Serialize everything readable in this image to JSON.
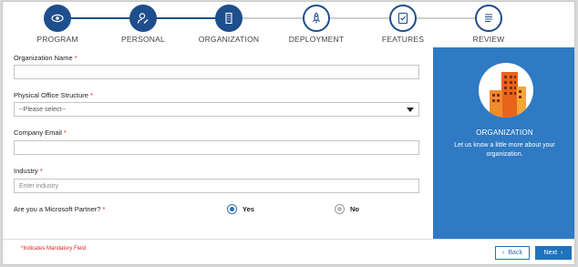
{
  "stepper": {
    "steps": [
      {
        "label": "PROGRAM",
        "icon": "eye-icon",
        "state": "done"
      },
      {
        "label": "PERSONAL",
        "icon": "user-edit-icon",
        "state": "done"
      },
      {
        "label": "ORGANIZATION",
        "icon": "building-icon",
        "state": "done"
      },
      {
        "label": "DEPLOYMENT",
        "icon": "rocket-icon",
        "state": "todo"
      },
      {
        "label": "FEATURES",
        "icon": "checklist-icon",
        "state": "todo"
      },
      {
        "label": "REVIEW",
        "icon": "document-list-icon",
        "state": "todo"
      }
    ],
    "progress_color": "#1e4e8c",
    "pending_color": "#cfcfcf"
  },
  "form": {
    "org_name": {
      "label": "Organization Name",
      "value": "",
      "required_mark": "*"
    },
    "office_structure": {
      "label": "Physical Office Structure",
      "selected": "--Please select--",
      "required_mark": "*"
    },
    "company_email": {
      "label": "Company Email",
      "value": "",
      "required_mark": "*"
    },
    "industry": {
      "label": "Industry",
      "placeholder": "Enter industry",
      "required_mark": "*"
    },
    "partner": {
      "label": "Are you a Microsoft Partner?",
      "required_mark": "*",
      "options": [
        {
          "label": "Yes",
          "selected": true
        },
        {
          "label": "No",
          "selected": false
        }
      ]
    }
  },
  "panel": {
    "title": "ORGANIZATION",
    "description": "Let us know a little more about your organization.",
    "icon": "building-illustration-icon",
    "background": "#2f7ac3"
  },
  "footer": {
    "mandatory_note": "*Indicates Mandatory Field",
    "back_label": "Back",
    "next_label": "Next"
  }
}
